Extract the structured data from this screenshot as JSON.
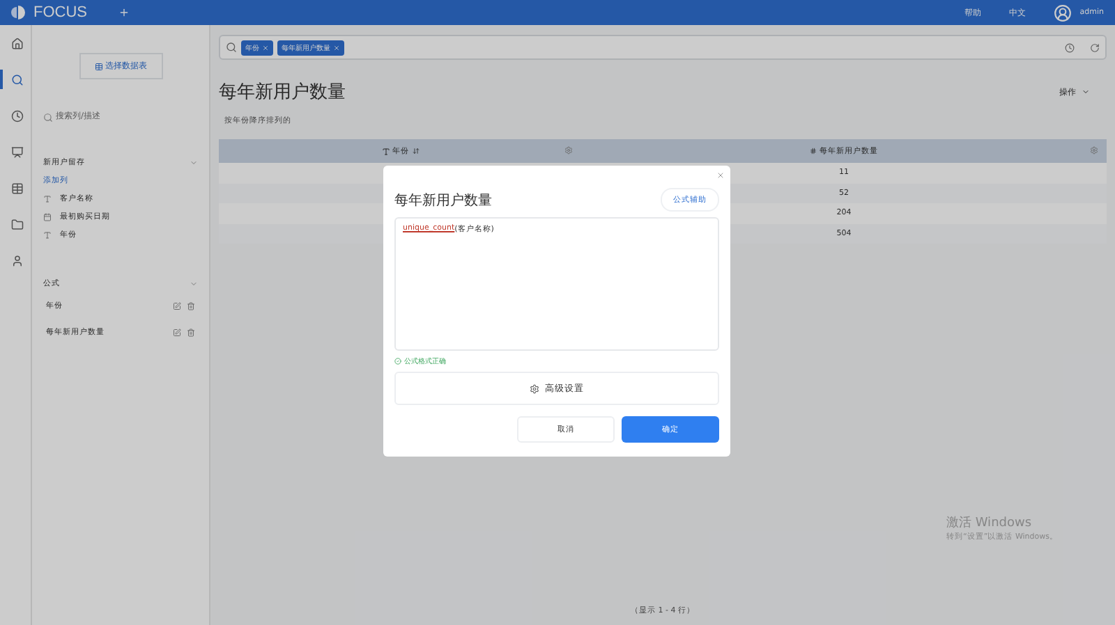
{
  "topbar": {
    "logo": "FOCUS",
    "links": [
      "帮助",
      "中文"
    ],
    "user": "admin"
  },
  "rail": [
    {
      "selected": false
    },
    {
      "selected": true
    },
    {
      "selected": false
    },
    {
      "selected": false
    },
    {
      "selected": false
    },
    {
      "selected": false
    },
    {
      "selected": false
    }
  ],
  "sidebar": {
    "choose_table": "选择数据表",
    "search_placeholder": "搜索列/描述",
    "table_group": {
      "title": "新用户留存",
      "add": "添加列",
      "columns": [
        {
          "kind": "text",
          "label": "客户名称"
        },
        {
          "kind": "date",
          "label": "最初购买日期"
        },
        {
          "kind": "text",
          "label": "年份"
        }
      ]
    },
    "formulas": {
      "title": "公式",
      "items": [
        "年份",
        "每年新用户数量"
      ]
    }
  },
  "search": {
    "tokens": [
      "年份",
      "每年新用户数量"
    ]
  },
  "answer": {
    "title": "每年新用户数量",
    "menu": "操作",
    "subtitle": "按年份降序排列的",
    "columns": [
      {
        "label": "年份",
        "kind": "text"
      },
      {
        "label": "每年新用户数量",
        "kind": "number"
      }
    ],
    "rows": [
      {
        "value": "11"
      },
      {
        "value": "52"
      },
      {
        "value": "204"
      },
      {
        "value": "504"
      }
    ],
    "footer": "（显示 1 - 4 行）"
  },
  "dialog": {
    "title": "每年新用户数量",
    "helper": "公式辅助",
    "formula_function": "unique_count",
    "formula_args": "(客户名称)",
    "status": "公式格式正确",
    "advanced": "高级设置",
    "cancel": "取消",
    "confirm": "确定"
  },
  "activation": {
    "title": "激活 Windows",
    "hint": "转到“设置”以激活 Windows。"
  }
}
